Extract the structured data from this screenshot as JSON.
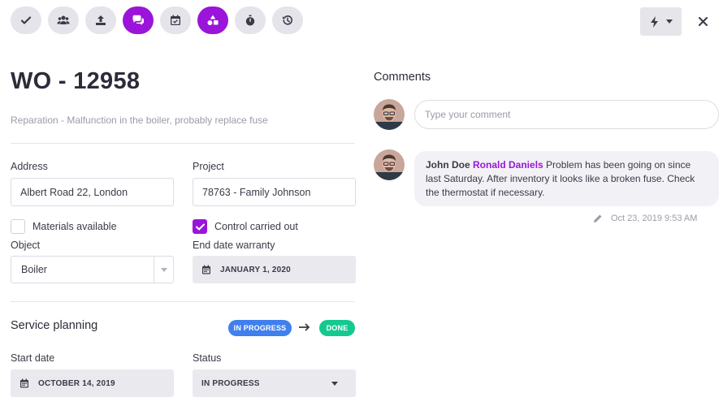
{
  "toolbar": {
    "buttons": [
      {
        "icon": "check-icon",
        "active": false
      },
      {
        "icon": "users-icon",
        "active": false
      },
      {
        "icon": "upload-icon",
        "active": false
      },
      {
        "icon": "comments-icon",
        "active": true
      },
      {
        "icon": "calendar-icon",
        "active": false
      },
      {
        "icon": "shapes-icon",
        "active": true
      },
      {
        "icon": "stopwatch-icon",
        "active": false
      },
      {
        "icon": "history-icon",
        "active": false
      }
    ],
    "actions_icon": "bolt-icon",
    "close_icon": "close-icon"
  },
  "work_order": {
    "title": "WO - 12958",
    "description": "Reparation - Malfunction in the boiler, probably replace fuse"
  },
  "form": {
    "address_label": "Address",
    "address_value": "Albert Road 22, London",
    "project_label": "Project",
    "project_value": "78763 - Family Johnson",
    "materials_label": "Materials available",
    "materials_checked": false,
    "control_label": "Control carried out",
    "control_checked": true,
    "object_label": "Object",
    "object_value": "Boiler",
    "warranty_label": "End date warranty",
    "warranty_value": "JANUARY 1, 2020"
  },
  "service_planning": {
    "title": "Service planning",
    "status_from": "IN PROGRESS",
    "status_to": "DONE",
    "start_date_label": "Start date",
    "start_date_value": "OCTOBER 14, 2019",
    "status_label": "Status",
    "status_value": "IN PROGRESS"
  },
  "comments": {
    "title": "Comments",
    "input_placeholder": "Type your comment",
    "items": [
      {
        "author": "John Doe",
        "mention": "Ronald Daniels",
        "text": "Problem has been going on since last Saturday. After inventory it looks like a broken fuse. Check the thermostat if necessary.",
        "timestamp": "Oct 23, 2019 9:53 AM"
      }
    ]
  },
  "colors": {
    "accent": "#9b14d9",
    "in_progress": "#3f7fee",
    "done": "#14c98f",
    "button_bg": "#e4e4ea"
  }
}
